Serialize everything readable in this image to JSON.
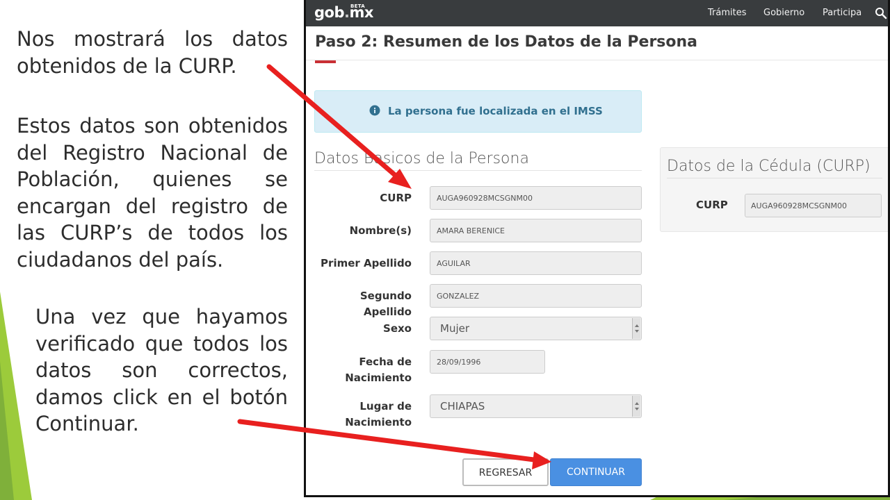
{
  "slide": {
    "paragraph_1": "Nos mostrará los datos obtenidos de la CURP.",
    "paragraph_2": "Estos datos son obtenidos del Registro Nacional de Población, quienes se encargan del registro de las CURP’s de todos los ciudadanos del país.",
    "paragraph_3": "Una vez que hayamos verificado que todos los datos son correctos, damos click en el botón Continuar."
  },
  "colors": {
    "navbar": "#393c3e",
    "accent_red": "#c92f35",
    "alert_bg": "#d9edf7",
    "alert_text": "#31708f",
    "primary_button": "#4a90e2",
    "arrow_red": "#e8201f",
    "slide_green": "#9ccb3b"
  },
  "navbar": {
    "logo": "gob",
    "logo_dot": ".",
    "logo_suffix": "mx",
    "beta": "BETA",
    "links": [
      "Trámites",
      "Gobierno",
      "Participa"
    ],
    "search_icon": "search-icon"
  },
  "page": {
    "title": "Paso 2: Resumen de los Datos de la Persona",
    "alert": "La persona fue localizada en el IMSS",
    "alert_icon": "info-icon"
  },
  "basic_data": {
    "title": "Datos Basicos de la Persona",
    "fields": [
      {
        "label": "CURP",
        "value": "AUGA960928MCSGNM00"
      },
      {
        "label": "Nombre(s)",
        "value": "AMARA BERENICE"
      },
      {
        "label": "Primer Apellido",
        "value": "AGUILAR"
      },
      {
        "label": "Segundo Apellido",
        "value": "GONZALEZ"
      },
      {
        "label": "Sexo",
        "value": "Mujer"
      },
      {
        "label_line1": "Fecha de",
        "label_line2": "Nacimiento",
        "value": "28/09/1996"
      },
      {
        "label_line1": "Lugar de",
        "label_line2": "Nacimiento",
        "value": "CHIAPAS"
      }
    ]
  },
  "cedula": {
    "title": "Datos de la Cédula (CURP)",
    "label": "CURP",
    "value": "AUGA960928MCSGNM00"
  },
  "buttons": {
    "back": "REGRESAR",
    "continue": "CONTINUAR"
  }
}
